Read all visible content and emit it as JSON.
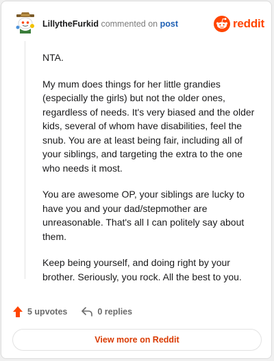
{
  "comment": {
    "username": "LillytheFurkid",
    "action_text": "commented on",
    "post_link_text": "post",
    "paragraphs": [
      "NTA.",
      "My mum does things for her little grandies (especially the girls) but not the older ones, regardless of needs. It's very biased and the older kids, several of whom have disabilities, feel the snub. You are at least being fair, including all of your siblings, and targeting the extra to the one who needs it most.",
      "You are awesome OP, your siblings are lucky to have you and your dad/stepmother are unreasonable. That's all I can politely say about them.",
      "Keep being yourself, and doing right by your brother. Seriously, you rock. All the best to you."
    ]
  },
  "brand": {
    "name": "reddit",
    "icon": "reddit-logo-icon",
    "color": "#ff4500"
  },
  "actions": {
    "upvotes": "5 upvotes",
    "replies": "0 replies",
    "upvote_icon": "upvote-arrow-icon",
    "reply_icon": "reply-arrow-icon"
  },
  "footer": {
    "view_more": "View more on Reddit"
  },
  "colors": {
    "upvote": "#ff4500",
    "link": "#1d5fb4",
    "cta": "#d93a00"
  }
}
